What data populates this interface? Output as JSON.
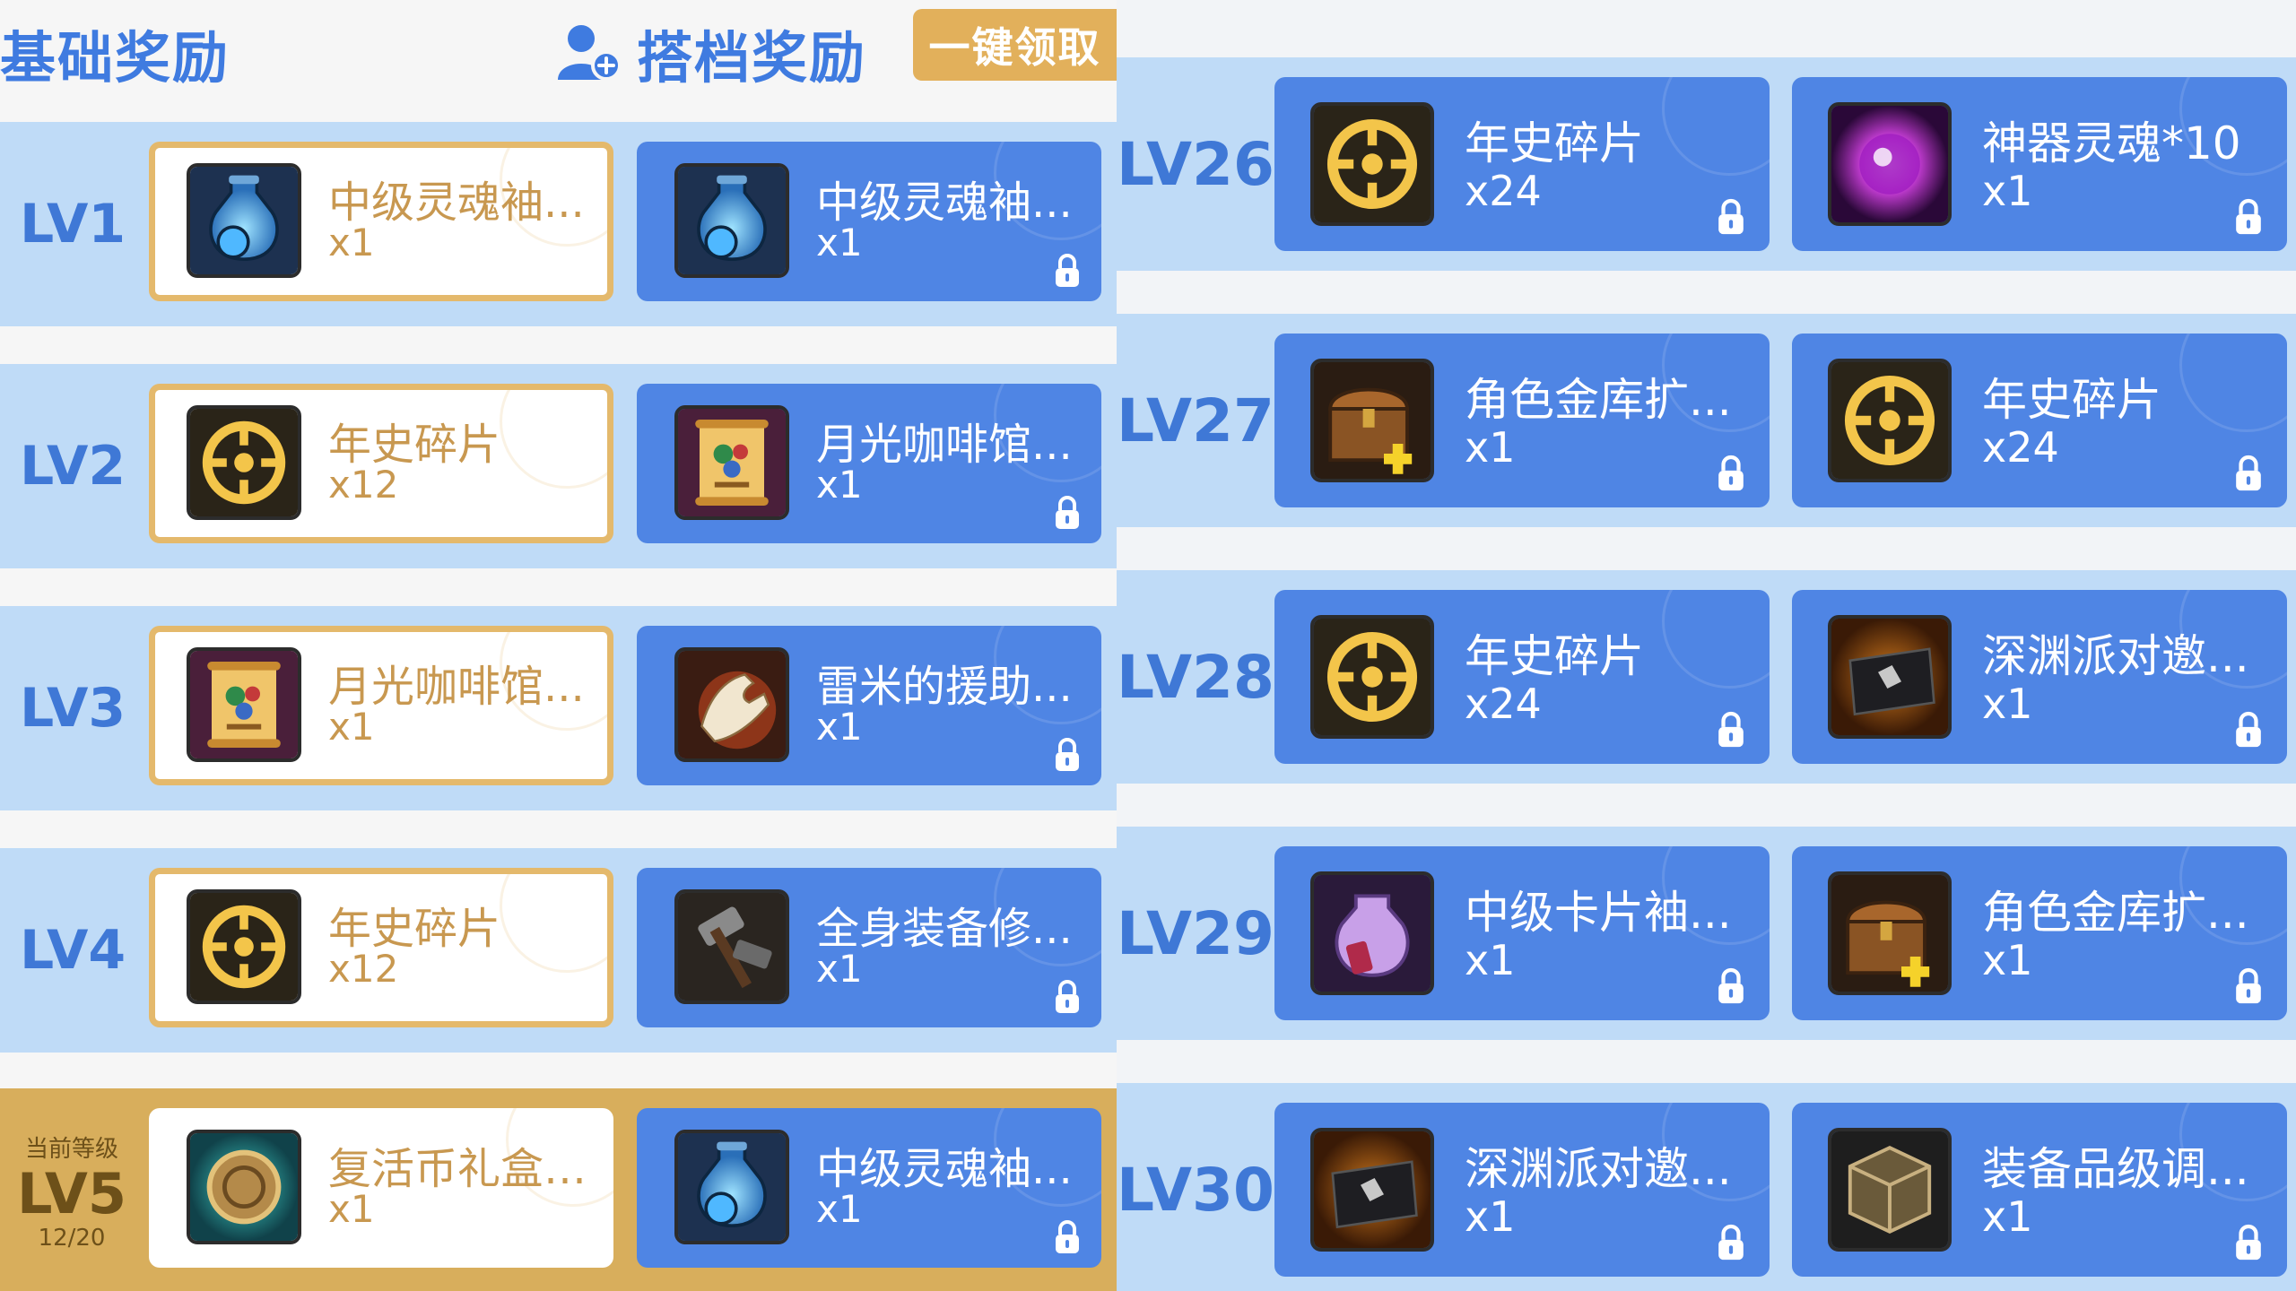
{
  "header": {
    "basic_title": "基础奖励",
    "partner_title": "搭档奖励",
    "claim_all_label": "一键领取"
  },
  "colors": {
    "accent_blue": "#3f7be0",
    "row_blue": "#bfdbf7",
    "locked_card": "#4f85e4",
    "gold": "#d8ae5c",
    "claim_button": "#e2b05b"
  },
  "current_level": {
    "caption": "当前等级",
    "label": "LV5",
    "progress": "12/20"
  },
  "left_rows": [
    {
      "level": "LV1",
      "basic": {
        "name": "中级灵魂袖...",
        "qty": "x1",
        "icon": "soul-pouch-icon",
        "state": "claimable"
      },
      "partner": {
        "name": "中级灵魂袖...",
        "qty": "x1",
        "icon": "soul-pouch-icon",
        "state": "locked"
      }
    },
    {
      "level": "LV2",
      "basic": {
        "name": "年史碎片",
        "qty": "x12",
        "icon": "chronicle-shard-icon",
        "state": "claimable"
      },
      "partner": {
        "name": "月光咖啡馆...",
        "qty": "x1",
        "icon": "scroll-icon",
        "state": "locked"
      }
    },
    {
      "level": "LV3",
      "basic": {
        "name": "月光咖啡馆...",
        "qty": "x1",
        "icon": "scroll-icon",
        "state": "claimable"
      },
      "partner": {
        "name": "雷米的援助...",
        "qty": "x1",
        "icon": "glove-icon",
        "state": "locked"
      }
    },
    {
      "level": "LV4",
      "basic": {
        "name": "年史碎片",
        "qty": "x12",
        "icon": "chronicle-shard-icon",
        "state": "claimable"
      },
      "partner": {
        "name": "全身装备修...",
        "qty": "x1",
        "icon": "hammer-icon",
        "state": "locked"
      }
    },
    {
      "level": "LV5",
      "current": true,
      "basic": {
        "name": "复活币礼盒(...",
        "qty": "x1",
        "icon": "revive-coin-icon",
        "state": "current"
      },
      "partner": {
        "name": "中级灵魂袖...",
        "qty": "x1",
        "icon": "soul-pouch-icon",
        "state": "locked"
      }
    }
  ],
  "right_rows": [
    {
      "level": "LV26",
      "basic": {
        "name": "年史碎片",
        "qty": "x24",
        "icon": "chronicle-shard-icon",
        "state": "locked"
      },
      "partner": {
        "name": "神器灵魂*10",
        "qty": "x1",
        "icon": "artifact-soul-icon",
        "state": "locked"
      }
    },
    {
      "level": "LV27",
      "basic": {
        "name": "角色金库扩...",
        "qty": "x1",
        "icon": "treasure-chest-icon",
        "state": "locked"
      },
      "partner": {
        "name": "年史碎片",
        "qty": "x24",
        "icon": "chronicle-shard-icon",
        "state": "locked"
      }
    },
    {
      "level": "LV28",
      "basic": {
        "name": "年史碎片",
        "qty": "x24",
        "icon": "chronicle-shard-icon",
        "state": "locked"
      },
      "partner": {
        "name": "深渊派对邀...",
        "qty": "x1",
        "icon": "abyss-invitation-icon",
        "state": "locked"
      }
    },
    {
      "level": "LV29",
      "basic": {
        "name": "中级卡片袖...",
        "qty": "x1",
        "icon": "card-pouch-icon",
        "state": "locked"
      },
      "partner": {
        "name": "角色金库扩...",
        "qty": "x1",
        "icon": "treasure-chest-icon",
        "state": "locked"
      }
    },
    {
      "level": "LV30",
      "basic": {
        "name": "深渊派对邀...",
        "qty": "x1",
        "icon": "abyss-invitation-icon",
        "state": "locked"
      },
      "partner": {
        "name": "装备品级调...",
        "qty": "x1",
        "icon": "equipment-box-icon",
        "state": "locked"
      }
    }
  ]
}
